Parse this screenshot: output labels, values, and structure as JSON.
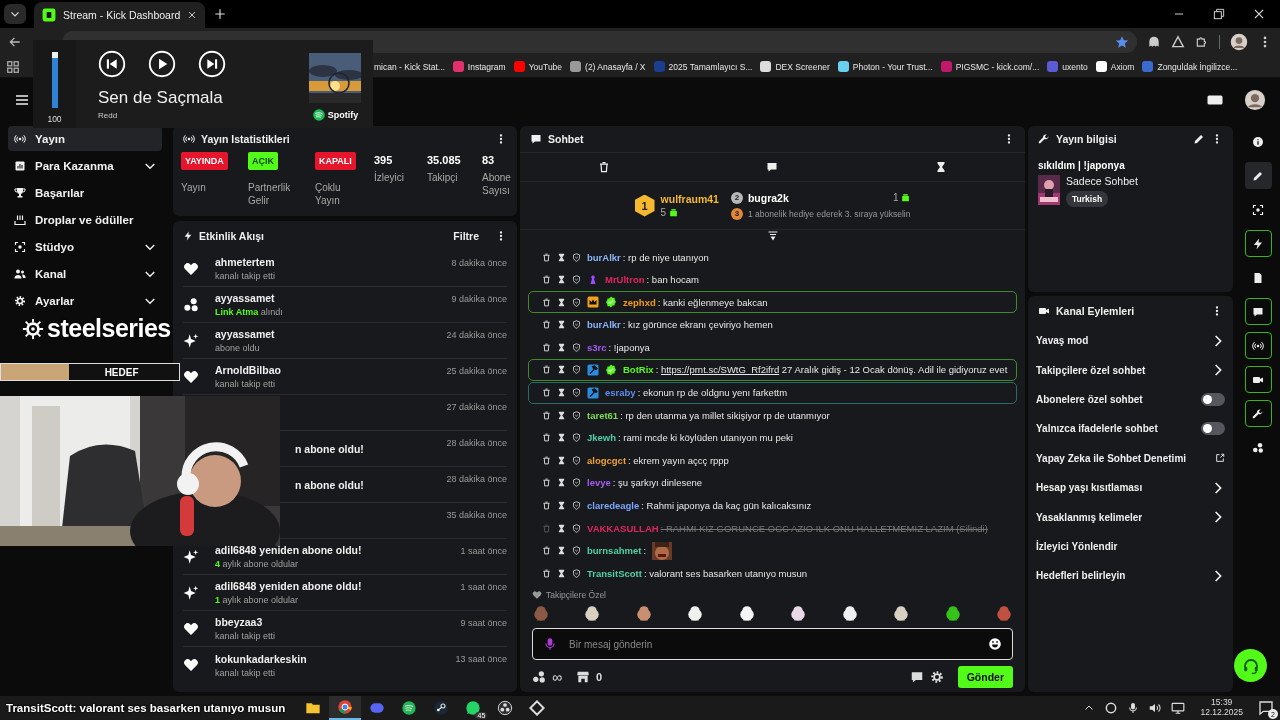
{
  "browser": {
    "tab": {
      "title": "Stream - Kick Dashboard"
    },
    "bookmarks": [
      "mican - Kick Stat...",
      "Instagram",
      "YouTube",
      "(2) Anasayfa / X",
      "2025 Tamamlayıcı S...",
      "DEX Screener",
      "Photon - Your Trust...",
      "PIGSMC - kick.com/...",
      "uxento",
      "Axiom",
      "Zonguldak İngilizce..."
    ]
  },
  "now_playing": {
    "volume": {
      "level": 1.0,
      "reading": "100"
    },
    "title": "Sen de Saçmala",
    "artist": "Redd",
    "service": "Spotify",
    "playing": false
  },
  "overlay": {
    "brand": "steelseries",
    "goal": {
      "label": "HEDEF",
      "level": 0.38
    }
  },
  "sidebar": {
    "items": [
      {
        "label": "Yayın",
        "selected": true,
        "expandable": false
      },
      {
        "label": "Para Kazanma",
        "selected": false,
        "expandable": true
      },
      {
        "label": "Başarılar",
        "selected": false,
        "expandable": false
      },
      {
        "label": "Droplar ve ödüller",
        "selected": false,
        "expandable": false
      },
      {
        "label": "Stüdyo",
        "selected": false,
        "expandable": true
      },
      {
        "label": "Kanal",
        "selected": false,
        "expandable": true
      },
      {
        "label": "Ayarlar",
        "selected": false,
        "expandable": true
      }
    ]
  },
  "stats": {
    "title": "Yayın Istatistikleri",
    "statuses": [
      {
        "badge": "YAYINDA",
        "label": "Yayın",
        "color": "#e5152b"
      },
      {
        "badge": "AÇIK",
        "label": "Partnerlik Gelir",
        "color": "#53fc18"
      },
      {
        "badge": "KAPALI",
        "label": "Çoklu Yayın",
        "color": "#e5152b"
      }
    ],
    "counters": [
      {
        "value": "395",
        "label": "İzleyici"
      },
      {
        "value": "35.085",
        "label": "Takipçi"
      },
      {
        "value": "83",
        "label": "Abone Sayısı"
      }
    ]
  },
  "activity": {
    "title": "Etkinlik Akışı",
    "filter": "Filtre",
    "events": [
      {
        "kind": "follow",
        "title": "ahmetertem",
        "detail": "kanalı takip etti",
        "time": "8 dakika önce"
      },
      {
        "kind": "reward",
        "title": "ayyassamet",
        "detail": "**Link Atma** alındı",
        "time": "9 dakika önce"
      },
      {
        "kind": "subscription",
        "title": "ayyassamet",
        "detail": "abone oldu",
        "time": "24 dakika önce"
      },
      {
        "kind": "follow",
        "title": "ArnoldBilbao",
        "detail": "kanalı takip etti",
        "time": "25 dakika önce"
      },
      {
        "time": "27 dakika önce"
      },
      {
        "title": "n abone oldu!",
        "time": "28 dakika önce"
      },
      {
        "title": "n abone oldu!",
        "time": "28 dakika önce"
      },
      {
        "time": "35 dakika önce"
      },
      {
        "kind": "subscription",
        "title": "adil6848 yeniden abone oldu!",
        "detail": "**4** aylık abone oldular",
        "time": "1 saat önce"
      },
      {
        "kind": "subscription",
        "title": "adil6848 yeniden abone oldu!",
        "detail": "**1** aylık abone oldular",
        "time": "1 saat önce"
      },
      {
        "kind": "follow",
        "title": "bbeyzaa3",
        "detail": "kanalı takip etti",
        "time": "9 saat önce"
      },
      {
        "kind": "follow",
        "title": "kokunkadarkeskin",
        "detail": "kanalı takip etti",
        "time": "13 saat önce"
      }
    ]
  },
  "chat": {
    "title": "Sohbet",
    "leaders": [
      {
        "rank": "1",
        "name": "wulfraum41",
        "count": "5"
      },
      {
        "rank": "2",
        "name": "bugra2k",
        "count": "1"
      }
    ],
    "next_rank": {
      "rank": "3",
      "text": "1 abonelik hediye ederek 3. sıraya yükselin"
    },
    "messages": [
      {
        "kind": "text",
        "user": "burAlkr",
        "color": "#8ab4f8",
        "text": ": rp de niye utanıyon",
        "deleted": false
      },
      {
        "kind": "text",
        "user": "MrUltron",
        "color": "#e0245e",
        "badges": [
          {
            "kind": "sub"
          }
        ],
        "text": ": ban hocam",
        "deleted": false
      },
      {
        "kind": "text",
        "user": "zephxd",
        "color": "#f39c12",
        "badges": [
          {
            "kind": "vip"
          },
          {
            "kind": "verified"
          }
        ],
        "text": ": kanki eğlenmeye bakcan",
        "deleted": false,
        "highlight": {
          "color": "#3f8a2a"
        }
      },
      {
        "kind": "text",
        "user": "burAlkr",
        "color": "#8ab4f8",
        "text": ": kız görünce ekranı çeviriyo hemen",
        "deleted": false
      },
      {
        "kind": "text",
        "user": "s3rc",
        "color": "#a45cf0",
        "text": ": !japonya",
        "deleted": false
      },
      {
        "kind": "text",
        "user": "BotRix",
        "color": "#53fc18",
        "badges": [
          {
            "kind": "moderator"
          },
          {
            "kind": "verified"
          }
        ],
        "text": ": ",
        "link": "https://prnt.sc/SWtG_Rf2ifrd",
        "text_after": "27 Aralık gidiş - 12 Ocak dönüş. Adil ile gidiyoruz evet",
        "deleted": false,
        "highlight": {
          "color": "#3f8a2a"
        }
      },
      {
        "kind": "text",
        "user": "esraby",
        "color": "#5b8def",
        "badges": [
          {
            "kind": "moderator"
          }
        ],
        "text": ": ekonun rp de oldgnu yenı farkettm",
        "deleted": false,
        "highlight": {
          "color": "#2a6a6a"
        }
      },
      {
        "kind": "text",
        "user": "taret61",
        "color": "#7ed957",
        "text": ": rp den utanma ya millet sikişiyor rp de utanmıyor",
        "deleted": false
      },
      {
        "kind": "text",
        "user": "Jkewh",
        "color": "#4fd1a5",
        "text": ": rami mcde ki köylüden utanıyon mu peki",
        "deleted": false
      },
      {
        "kind": "text",
        "user": "alogcgct",
        "color": "#f0a030",
        "text": ": ekrem yayın açcç rppp",
        "deleted": false
      },
      {
        "kind": "text",
        "user": "levye",
        "color": "#a45cf0",
        "text": ": şu şarkıyı dinlesene",
        "deleted": false
      },
      {
        "kind": "text",
        "user": "claredeagle",
        "color": "#7aa7ff",
        "text": ": Rahmi japonya da kaç gün kalıcaksınız",
        "deleted": false
      },
      {
        "kind": "text",
        "user": "VAKKASULLAH",
        "color": "#e0245e",
        "text": ": RAHMI KIZ GORUNCE OCC AZIO ILK ONU HALLETMEMIZ LAZIM (Silindi)",
        "deleted": true
      },
      {
        "kind": "emote",
        "user": "burnsahmet",
        "color": "#4fd1a5",
        "text": ":",
        "deleted": false
      },
      {
        "kind": "text",
        "user": "TransitScott",
        "color": "#4fd1a5",
        "text": ": valorant ses basarken utanıyo musun",
        "deleted": false
      }
    ],
    "emote_section": "Takipçilere Özel",
    "input": {
      "placeholder": "Bir mesaj gönderin"
    },
    "infinity": "∞",
    "points": "0",
    "send": "Gönder"
  },
  "stream_info": {
    "title": "Yayın bilgisi",
    "stream_title": "sıkıldım | !japonya",
    "category": "Sadece Sohbet",
    "tags": [
      "Turkish"
    ]
  },
  "channel_actions": {
    "title": "Kanal Eylemleri",
    "items": [
      {
        "label": "Yavaş mod",
        "kind": "submenu"
      },
      {
        "label": "Takipçilere özel sohbet",
        "kind": "submenu"
      },
      {
        "label": "Abonelere özel sohbet",
        "kind": "toggle",
        "on": false
      },
      {
        "label": "Yalnızca ifadelerle sohbet",
        "kind": "toggle",
        "on": false
      },
      {
        "label": "Yapay Zeka ile Sohbet Denetimi",
        "kind": "external"
      },
      {
        "label": "Hesap yaşı kısıtlaması",
        "kind": "submenu"
      },
      {
        "label": "Yasaklanmış kelimeler",
        "kind": "submenu"
      },
      {
        "label": "İzleyici Yönlendir",
        "kind": "action"
      },
      {
        "label": "Hedefleri belirleyin",
        "kind": "submenu"
      }
    ]
  },
  "rail": [
    {
      "selected": false,
      "pinned": false
    },
    {
      "selected": true,
      "pinned": false
    },
    {
      "selected": false,
      "pinned": false
    },
    {
      "selected": false,
      "pinned": true
    },
    {
      "selected": false,
      "pinned": false
    },
    {
      "selected": false,
      "pinned": true
    },
    {
      "selected": false,
      "pinned": true
    },
    {
      "selected": false,
      "pinned": true
    },
    {
      "selected": false,
      "pinned": true
    },
    {
      "selected": false,
      "pinned": false
    }
  ],
  "taskbar": {
    "caption": "TransitScott: valorant ses basarken utanıyo musun",
    "whatsapp_badge": "45",
    "time": "15:39",
    "date": "12.12.2025",
    "notifications": "2"
  }
}
